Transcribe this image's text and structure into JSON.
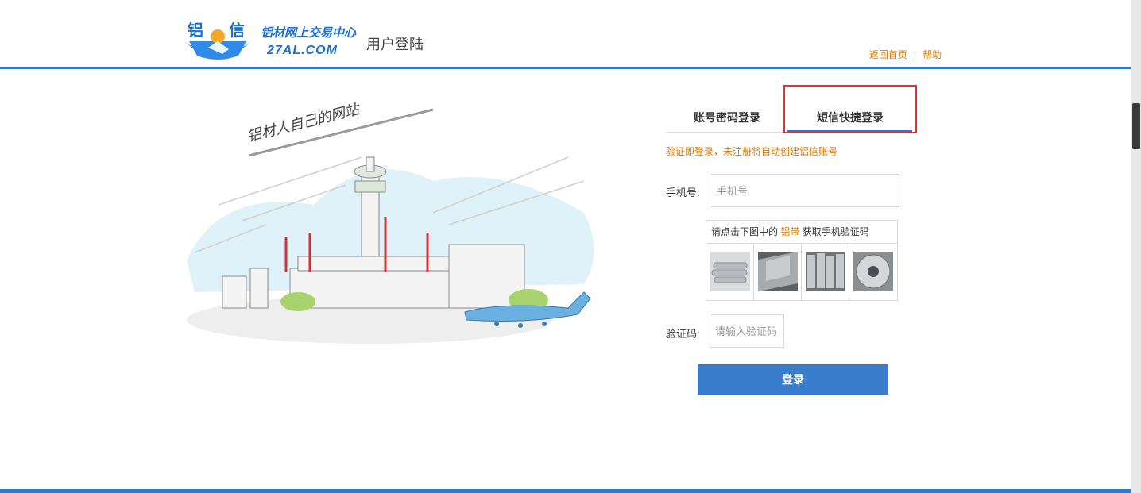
{
  "header": {
    "logo_char_left": "铝",
    "logo_char_right": "信",
    "logo_subtitle": "铝材网上交易中心",
    "logo_domain": "27AL.COM",
    "page_title": "用户登陆",
    "links": {
      "home": "返回首页",
      "separator": "|",
      "help": "帮助"
    }
  },
  "illustration": {
    "caption": "铝材人自己的网站"
  },
  "tabs": {
    "password_login": "账号密码登录",
    "sms_login": "短信快捷登录",
    "active": "sms_login"
  },
  "notice": "验证即登录，未注册将自动创建铝信账号",
  "phone": {
    "label": "手机号:",
    "placeholder": "手机号"
  },
  "captcha": {
    "prompt_before": "请点击下图中的",
    "keyword": "铝带",
    "prompt_after": "获取手机验证码",
    "images": [
      "aluminum-tubes",
      "aluminum-sheet",
      "aluminum-ingots",
      "aluminum-coil"
    ]
  },
  "code": {
    "label": "验证码:",
    "placeholder": "请输入验证码"
  },
  "submit_label": "登录",
  "colors": {
    "accent_blue": "#2f7ad0",
    "accent_orange": "#e07a00",
    "highlight_red": "#e03030"
  }
}
